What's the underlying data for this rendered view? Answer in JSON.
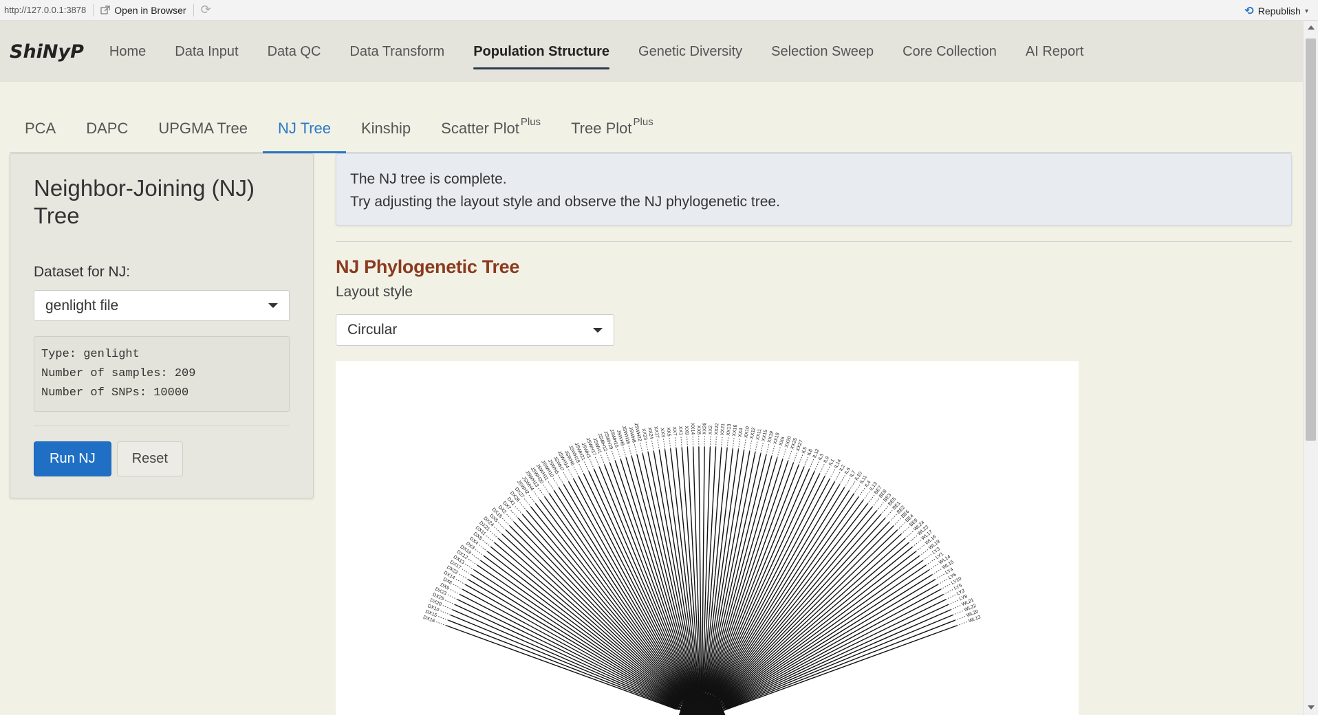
{
  "viewer": {
    "url": "http://127.0.0.1:3878",
    "open_in_browser": "Open in Browser",
    "republish": "Republish"
  },
  "navbar": {
    "brand": "ShiNyP",
    "items": [
      {
        "label": "Home",
        "active": false
      },
      {
        "label": "Data Input",
        "active": false
      },
      {
        "label": "Data QC",
        "active": false
      },
      {
        "label": "Data Transform",
        "active": false
      },
      {
        "label": "Population Structure",
        "active": true
      },
      {
        "label": "Genetic Diversity",
        "active": false
      },
      {
        "label": "Selection Sweep",
        "active": false
      },
      {
        "label": "Core Collection",
        "active": false
      },
      {
        "label": "AI Report",
        "active": false
      }
    ]
  },
  "subtabs": {
    "items": [
      {
        "label": "PCA",
        "sup": ""
      },
      {
        "label": "DAPC",
        "sup": ""
      },
      {
        "label": "UPGMA Tree",
        "sup": ""
      },
      {
        "label": "NJ Tree",
        "sup": ""
      },
      {
        "label": "Kinship",
        "sup": ""
      },
      {
        "label": "Scatter Plot",
        "sup": "Plus"
      },
      {
        "label": "Tree Plot",
        "sup": "Plus"
      }
    ],
    "active_index": 3
  },
  "sidebar": {
    "title": "Neighbor-Joining (NJ) Tree",
    "dataset_label": "Dataset for NJ:",
    "dataset_value": "genlight file",
    "info_lines": [
      "Type: genlight",
      "Number of samples: 209",
      "Number of SNPs: 10000"
    ],
    "run_button": "Run NJ",
    "reset_button": "Reset"
  },
  "main": {
    "alert_line1": "The NJ tree is complete.",
    "alert_line2": "Try adjusting the layout style and observe the NJ phylogenetic tree.",
    "tree_title": "NJ Phylogenetic Tree",
    "layout_label": "Layout style",
    "layout_value": "Circular"
  },
  "tree": {
    "leaf_labels_left_to_right": [
      "DX16",
      "DX15",
      "DX10",
      "DX20",
      "DX25",
      "DX23",
      "DX9",
      "DX6",
      "DX14",
      "DX22",
      "DX17",
      "DX13",
      "DX12",
      "DX19",
      "DX3",
      "DX4",
      "DX8",
      "DX11",
      "DX21",
      "DX24",
      "DX5",
      "DX18",
      "DX2",
      "DX7",
      "DX1",
      "DX26",
      "DX27",
      "JSWH2",
      "JSWH4",
      "JSWH13",
      "JSWH20",
      "JSWH11",
      "JSWH10",
      "JSWH5",
      "JSWH7",
      "JSWH14",
      "JSWH6",
      "JSWH18",
      "JSWH21",
      "JSWH3",
      "JSWH17",
      "JSWH1",
      "JSWH12",
      "JSWH19",
      "JSWH15",
      "JSWH9",
      "JSWH16",
      "JSWH8",
      "JSWH22",
      "XX23",
      "XX24",
      "XX17",
      "XX3",
      "XX5",
      "XX7",
      "XX1",
      "XX9",
      "XX14",
      "XX8",
      "XX26",
      "XX2",
      "XX22",
      "XX21",
      "XX13",
      "XX16",
      "XX4",
      "XX10",
      "XX12",
      "XX11",
      "XX15",
      "XX19",
      "XX18",
      "XX6",
      "XX20",
      "XX25",
      "XX27",
      "IL5",
      "IL8",
      "IL12",
      "IL3",
      "IL9",
      "IL1",
      "IL14",
      "IL2",
      "IL6",
      "IL7",
      "IL10",
      "IL11",
      "IL4",
      "IL13",
      "BE7",
      "BE8",
      "BE3",
      "BE5",
      "BE1",
      "BE2",
      "BE6",
      "BE4",
      "BE9",
      "WL24",
      "WL23",
      "WL17",
      "WL16",
      "WL19",
      "LY3",
      "LY1",
      "WL14",
      "WL15",
      "LY4",
      "LY6",
      "LY10",
      "LY5",
      "LY2",
      "LY8",
      "WL21",
      "WL22",
      "WL20",
      "WL13"
    ]
  }
}
